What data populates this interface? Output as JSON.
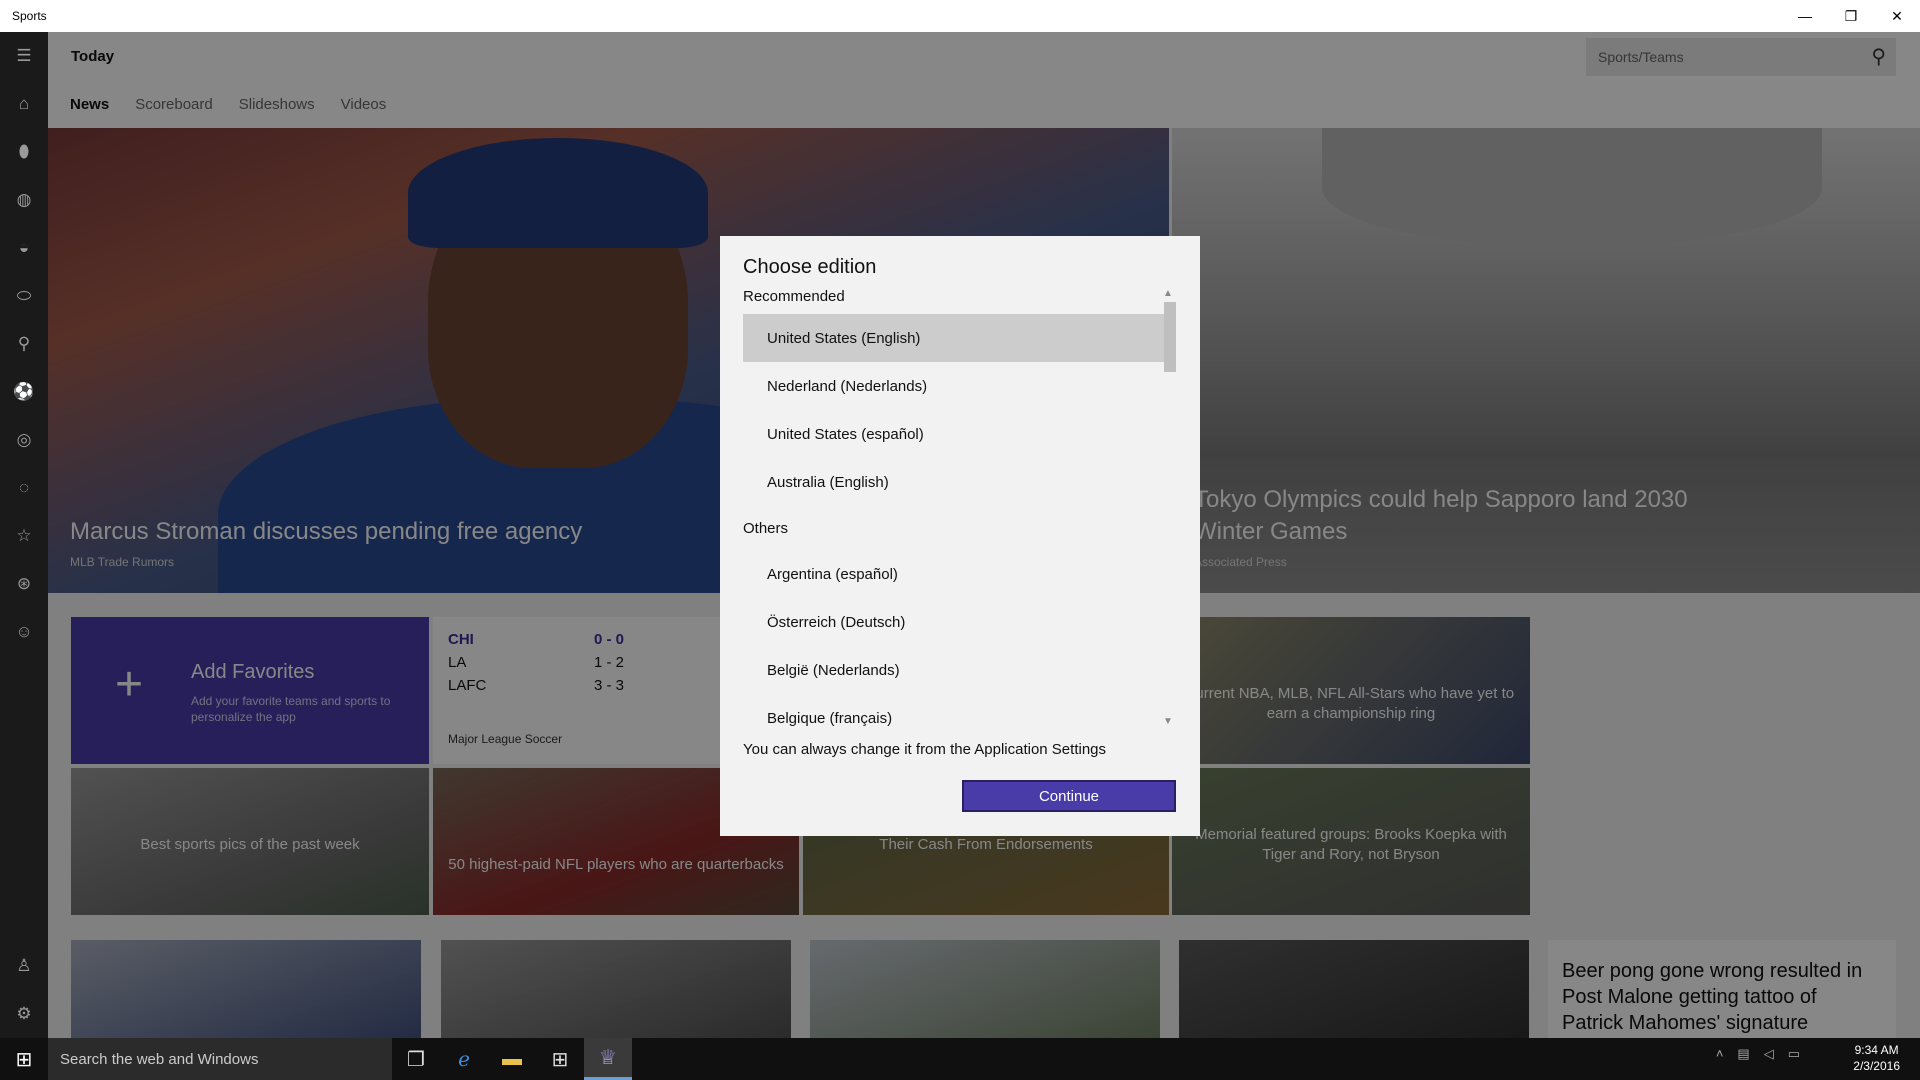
{
  "window": {
    "title": "Sports",
    "controls": [
      "—",
      "❐",
      "✕"
    ]
  },
  "header": {
    "page_title": "Today",
    "search_placeholder": "Sports/Teams"
  },
  "tabs": [
    {
      "label": "News",
      "active": true
    },
    {
      "label": "Scoreboard",
      "active": false
    },
    {
      "label": "Slideshows",
      "active": false
    },
    {
      "label": "Videos",
      "active": false
    }
  ],
  "rail_icons": [
    "menu-icon",
    "home-icon",
    "football-icon",
    "basketball-icon",
    "rugby-icon",
    "baseball-icon",
    "golf-icon",
    "soccer-icon",
    "tennis-icon",
    "hockey-icon",
    "favorites-icon",
    "motorsport-icon",
    "fan-icon",
    "account-icon",
    "settings-icon"
  ],
  "heroes": [
    {
      "caption": "Marcus Stroman discusses pending free agency",
      "source": "MLB Trade Rumors"
    },
    {
      "caption": "Tokyo Olympics could help Sapporo land 2030 Winter Games",
      "source": "Associated Press"
    }
  ],
  "favorites_tile": {
    "title": "Add Favorites",
    "subtitle": "Add your favorite teams and sports to personalize the app"
  },
  "scores": {
    "rows": [
      {
        "team": "CHI",
        "score": "0  -  0"
      },
      {
        "team": "LA",
        "score": "1  -  2"
      },
      {
        "team": "LAFC",
        "score": "3  -  3"
      }
    ],
    "source": "Major League Soccer"
  },
  "tiles": {
    "nba_caption": "current NBA, MLB, NFL All-Stars who have yet to earn a championship ring",
    "pics_caption": "Best sports pics of the past week",
    "nfl_caption": "50 highest-paid NFL players who are quarterbacks",
    "cash_caption": "Their Cash From Endorsements",
    "memorial_caption": "Memorial featured groups: Brooks Koepka with Tiger and Rory, not Bryson",
    "beer_pong": "Beer pong gone wrong resulted in Post Malone getting tattoo of Patrick Mahomes' signature"
  },
  "dialog": {
    "title": "Choose edition",
    "recommended_label": "Recommended",
    "recommended": [
      {
        "label": "United States (English)",
        "selected": true
      },
      {
        "label": "Nederland (Nederlands)",
        "selected": false
      },
      {
        "label": "United States (español)",
        "selected": false
      },
      {
        "label": "Australia (English)",
        "selected": false
      }
    ],
    "others_label": "Others",
    "others": [
      {
        "label": "Argentina (español)"
      },
      {
        "label": "Österreich (Deutsch)"
      },
      {
        "label": "België (Nederlands)"
      },
      {
        "label": "Belgique (français)"
      }
    ],
    "note": "You can always change it from the Application Settings",
    "continue_label": "Continue"
  },
  "taskbar": {
    "search_placeholder": "Search the web and Windows",
    "time": "9:34 AM",
    "date": "2/3/2016"
  },
  "colors": {
    "accent": "#4a3ca8",
    "dialog_bg": "#f2f2f2",
    "selected": "#cccccc"
  }
}
